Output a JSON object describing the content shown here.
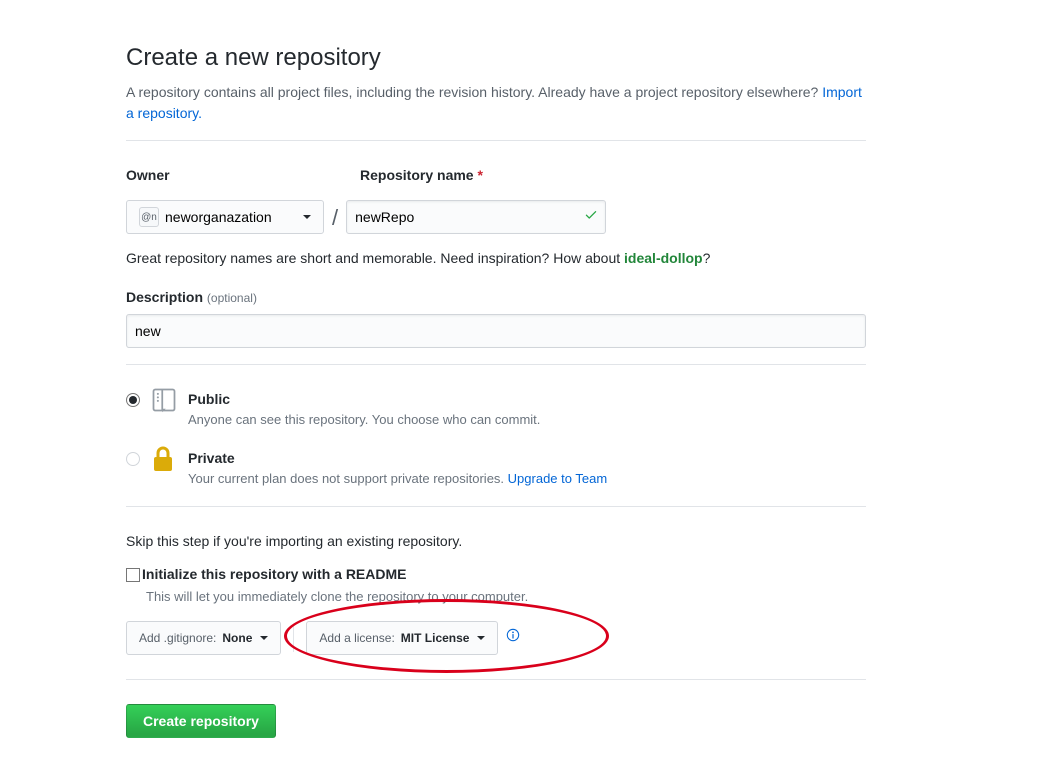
{
  "header": {
    "title": "Create a new repository",
    "subhead_prefix": "A repository contains all project files, including the revision history. Already have a project repository elsewhere? ",
    "import_link": "Import a repository."
  },
  "owner": {
    "label": "Owner",
    "avatar_text": "@n",
    "value": "neworganazation"
  },
  "repo_name": {
    "label": "Repository name",
    "value": "newRepo"
  },
  "name_hint": {
    "prefix": "Great repository names are short and memorable. Need inspiration? How about ",
    "suggestion": "ideal-dollop",
    "suffix": "?"
  },
  "description": {
    "label": "Description",
    "optional": "(optional)",
    "value": "new"
  },
  "visibility": {
    "public": {
      "label": "Public",
      "sub": "Anyone can see this repository. You choose who can commit."
    },
    "private": {
      "label": "Private",
      "sub_prefix": "Your current plan does not support private repositories. ",
      "upgrade_link": "Upgrade to Team"
    }
  },
  "init": {
    "skip_note": "Skip this step if you're importing an existing repository.",
    "readme_label": "Initialize this repository with a README",
    "readme_sub": "This will let you immediately clone the repository to your computer."
  },
  "gitignore": {
    "prefix": "Add .gitignore: ",
    "value": "None"
  },
  "license": {
    "prefix": "Add a license: ",
    "value": "MIT License"
  },
  "submit": {
    "label": "Create repository"
  }
}
